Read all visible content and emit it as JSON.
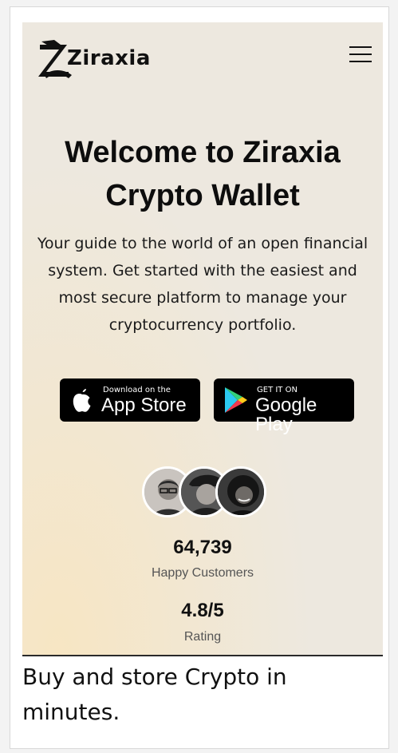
{
  "header": {
    "logo_text": "Ziraxia",
    "menu_icon": "hamburger-menu-icon"
  },
  "hero": {
    "title_line1": "Welcome to Ziraxia",
    "title_line2": "Crypto Wallet",
    "description_line1": "Your guide to the world of an open financial",
    "description_line2": "system. Get started with the easiest and",
    "description_line3": "most secure platform to manage your",
    "description_line4": "cryptocurrency portfolio."
  },
  "app_store": {
    "small": "Download on the",
    "big": "App Store",
    "icon": "apple-icon"
  },
  "google_play": {
    "small": "GET IT ON",
    "big": "Google Play",
    "icon": "google-play-icon"
  },
  "stats": {
    "customers_value": "64,739",
    "customers_label": "Happy Customers",
    "rating_value": "4.8/5",
    "rating_label": "Rating"
  },
  "below_section": {
    "heading": "Buy and store Crypto in minutes."
  },
  "colors": {
    "hero_background": "#ede8df",
    "hero_glow": "#f7e6c3",
    "button_background": "#000000",
    "text_primary": "#0d0d0d",
    "text_muted": "#555555"
  }
}
